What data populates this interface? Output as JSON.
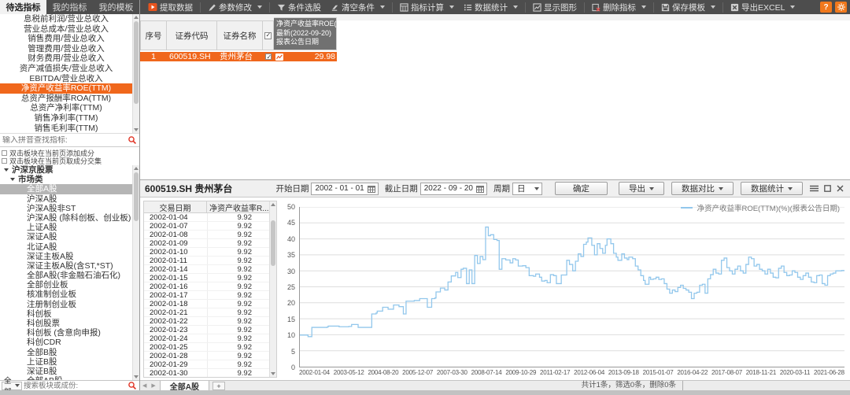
{
  "sidebar": {
    "tabs": [
      "待选指标",
      "我的指标",
      "我的模板"
    ],
    "active_tab": "待选指标",
    "indicators": [
      "息税前利润/营业总收入",
      "营业总成本/营业总收入",
      "销售费用/营业总收入",
      "管理费用/营业总收入",
      "财务费用/营业总收入",
      "资产减值损失/营业总收入",
      "EBITDA/营业总收入",
      "净资产收益率ROE(TTM)",
      "总资产报酬率ROA(TTM)",
      "总资产净利率(TTM)",
      "销售净利率(TTM)",
      "销售毛利率(TTM)"
    ],
    "selected_indicator_index": 7,
    "indicator_search_placeholder": "输入拼音查找指标:",
    "options": [
      "双击板块在当前页添加成分",
      "双击板块在当前页取成分交集"
    ],
    "tree_root": "沪深京股票",
    "tree_group": "市场类",
    "tree_items": [
      "全部A股",
      "沪深A股",
      "沪深A股非ST",
      "沪深A股 (除科创板、创业板)",
      "上证A股",
      "深证A股",
      "北证A股",
      "深证主板A股",
      "深证主板A股(含ST,*ST)",
      "全部A股(非金融石油石化)",
      "全部创业板",
      "核准制创业板",
      "注册制创业板",
      "科创板",
      "科创股票",
      "科创板 (含意向申报)",
      "科创CDR",
      "全部B股",
      "上证B股",
      "深证B股",
      "全部AB股"
    ],
    "tree_selected": "全部A股",
    "board_filter_value": "全部",
    "board_search_placeholder": "搜索板块或成份:"
  },
  "toolbar": {
    "extract": "提取数据",
    "modify_params": "参数修改",
    "stock_filter": "条件选股",
    "clear_conditions": "清空条件",
    "indicator_calc": "指标计算",
    "data_stats": "数据统计",
    "show_chart": "显示图形",
    "delete_indicator": "删除指标",
    "save_template": "保存模板",
    "export_excel": "导出EXCEL",
    "help": "?"
  },
  "results": {
    "columns": {
      "seq": "序号",
      "code": "证券代码",
      "name": "证券名称"
    },
    "indicator_column": {
      "title": "净资产收益率ROE(...",
      "line2": "最新(2022-09-20)",
      "line3": "报表公告日期"
    },
    "rows": [
      {
        "seq": "1",
        "code": "600519.SH",
        "name": "贵州茅台",
        "checked": true,
        "value": "29.98"
      }
    ]
  },
  "detail": {
    "title": "600519.SH 贵州茅台",
    "start_label": "开始日期",
    "start_value": "2002 - 01 - 01",
    "end_label": "截止日期",
    "end_value": "2022 - 09 - 20",
    "period_label": "周期",
    "period_value": "日",
    "confirm": "确定",
    "export": "导出",
    "compare": "数据对比",
    "stats": "数据统计",
    "table": {
      "date_col": "交易日期",
      "value_col": "净资产收益率R...",
      "value": "9.92",
      "dates": [
        "2002-01-04",
        "2002-01-07",
        "2002-01-08",
        "2002-01-09",
        "2002-01-10",
        "2002-01-11",
        "2002-01-14",
        "2002-01-15",
        "2002-01-16",
        "2002-01-17",
        "2002-01-18",
        "2002-01-21",
        "2002-01-22",
        "2002-01-23",
        "2002-01-24",
        "2002-01-25",
        "2002-01-28",
        "2002-01-29",
        "2002-01-30"
      ]
    },
    "tab": "全部A股",
    "add_tab": "+"
  },
  "status_bar": "共计1条，筛选0条，删除0条",
  "chart_data": {
    "type": "line",
    "step": true,
    "legend": "净资产收益率ROE(TTM)(%)(报表公告日期)",
    "series_name": "净资产收益率ROE(TTM)(%)",
    "x_range": [
      "2002-01-01",
      "2022-09-20"
    ],
    "ylim": [
      0,
      50
    ],
    "yticks": [
      0,
      5,
      10,
      15,
      20,
      25,
      30,
      35,
      40,
      45,
      50
    ],
    "x_tick_labels": [
      "2002-01-04",
      "2003-05-12",
      "2004-08-20",
      "2005-12-07",
      "2007-03-30",
      "2008-07-14",
      "2009-10-29",
      "2011-02-17",
      "2012-06-04",
      "2013-09-18",
      "2015-01-07",
      "2016-04-22",
      "2017-08-07",
      "2018-11-21",
      "2020-03-11",
      "2021-06-28"
    ],
    "line_color": "#92c7ec",
    "points": [
      [
        0,
        9.9
      ],
      [
        0.013,
        9.9
      ],
      [
        0.015,
        9.4
      ],
      [
        0.02,
        9.4
      ],
      [
        0.022,
        12.3
      ],
      [
        0.05,
        12.4
      ],
      [
        0.052,
        12.7
      ],
      [
        0.07,
        12.7
      ],
      [
        0.072,
        12.5
      ],
      [
        0.09,
        12.6
      ],
      [
        0.095,
        13.2
      ],
      [
        0.105,
        13.2
      ],
      [
        0.107,
        12.3
      ],
      [
        0.13,
        12.3
      ],
      [
        0.132,
        16.5
      ],
      [
        0.14,
        16.8
      ],
      [
        0.142,
        17.4
      ],
      [
        0.15,
        17.4
      ],
      [
        0.152,
        18.6
      ],
      [
        0.16,
        18.6
      ],
      [
        0.162,
        18.0
      ],
      [
        0.17,
        18.0
      ],
      [
        0.172,
        19.3
      ],
      [
        0.18,
        19.3
      ],
      [
        0.182,
        18.8
      ],
      [
        0.188,
        18.8
      ],
      [
        0.19,
        16.5
      ],
      [
        0.193,
        16.5
      ],
      [
        0.195,
        20.5
      ],
      [
        0.21,
        20.7
      ],
      [
        0.22,
        21.3
      ],
      [
        0.232,
        21.3
      ],
      [
        0.234,
        18.6
      ],
      [
        0.24,
        18.6
      ],
      [
        0.242,
        21.3
      ],
      [
        0.248,
        21.5
      ],
      [
        0.25,
        23.4
      ],
      [
        0.256,
        23.4
      ],
      [
        0.258,
        24.6
      ],
      [
        0.264,
        24.6
      ],
      [
        0.266,
        24.0
      ],
      [
        0.27,
        24.0
      ],
      [
        0.272,
        26.5
      ],
      [
        0.276,
        26.5
      ],
      [
        0.278,
        28.4
      ],
      [
        0.284,
        28.4
      ],
      [
        0.286,
        29.5
      ],
      [
        0.289,
        29.5
      ],
      [
        0.29,
        27.9
      ],
      [
        0.294,
        27.9
      ],
      [
        0.296,
        30.5
      ],
      [
        0.3,
        30.8
      ],
      [
        0.304,
        30.8
      ],
      [
        0.306,
        26.0
      ],
      [
        0.309,
        26.0
      ],
      [
        0.311,
        30.3
      ],
      [
        0.314,
        30.3
      ],
      [
        0.316,
        26.0
      ],
      [
        0.319,
        26.0
      ],
      [
        0.321,
        34.8
      ],
      [
        0.324,
        34.8
      ],
      [
        0.326,
        32.3
      ],
      [
        0.329,
        32.3
      ],
      [
        0.331,
        34.5
      ],
      [
        0.334,
        34.5
      ],
      [
        0.336,
        33.5
      ],
      [
        0.339,
        33.5
      ],
      [
        0.341,
        43.7
      ],
      [
        0.344,
        43.7
      ],
      [
        0.346,
        41.0
      ],
      [
        0.35,
        41.3
      ],
      [
        0.354,
        41.3
      ],
      [
        0.356,
        39.8
      ],
      [
        0.36,
        39.8
      ],
      [
        0.362,
        39.5
      ],
      [
        0.364,
        39.5
      ],
      [
        0.366,
        30.5
      ],
      [
        0.369,
        30.5
      ],
      [
        0.371,
        33.8
      ],
      [
        0.376,
        33.8
      ],
      [
        0.378,
        33.4
      ],
      [
        0.384,
        33.4
      ],
      [
        0.386,
        32.5
      ],
      [
        0.389,
        32.5
      ],
      [
        0.391,
        33.8
      ],
      [
        0.394,
        33.8
      ],
      [
        0.396,
        33.4
      ],
      [
        0.399,
        33.4
      ],
      [
        0.401,
        31.5
      ],
      [
        0.409,
        31.6
      ],
      [
        0.415,
        31.0
      ],
      [
        0.419,
        31.0
      ],
      [
        0.421,
        28.5
      ],
      [
        0.429,
        28.3
      ],
      [
        0.433,
        29.0
      ],
      [
        0.438,
        29.0
      ],
      [
        0.44,
        28.0
      ],
      [
        0.444,
        26.8
      ],
      [
        0.45,
        27.0
      ],
      [
        0.454,
        26.3
      ],
      [
        0.458,
        26.3
      ],
      [
        0.46,
        28.8
      ],
      [
        0.466,
        28.5
      ],
      [
        0.469,
        28.5
      ],
      [
        0.471,
        26.0
      ],
      [
        0.478,
        26.0
      ],
      [
        0.48,
        28.7
      ],
      [
        0.488,
        28.7
      ],
      [
        0.49,
        33.3
      ],
      [
        0.493,
        33.3
      ],
      [
        0.495,
        32.0
      ],
      [
        0.499,
        32.0
      ],
      [
        0.501,
        30.0
      ],
      [
        0.504,
        30.0
      ],
      [
        0.506,
        33.0
      ],
      [
        0.509,
        33.0
      ],
      [
        0.511,
        35.3
      ],
      [
        0.514,
        35.3
      ],
      [
        0.516,
        34.5
      ],
      [
        0.519,
        34.5
      ],
      [
        0.521,
        38.3
      ],
      [
        0.524,
        38.3
      ],
      [
        0.526,
        39.0
      ],
      [
        0.529,
        40.3
      ],
      [
        0.534,
        40.3
      ],
      [
        0.536,
        38.0
      ],
      [
        0.539,
        38.0
      ],
      [
        0.541,
        35.0
      ],
      [
        0.544,
        35.0
      ],
      [
        0.546,
        38.5
      ],
      [
        0.549,
        38.5
      ],
      [
        0.551,
        37.0
      ],
      [
        0.554,
        37.0
      ],
      [
        0.556,
        35.5
      ],
      [
        0.559,
        35.5
      ],
      [
        0.561,
        38.0
      ],
      [
        0.564,
        40.0
      ],
      [
        0.569,
        40.0
      ],
      [
        0.571,
        38.5
      ],
      [
        0.574,
        38.5
      ],
      [
        0.576,
        35.5
      ],
      [
        0.579,
        35.5
      ],
      [
        0.581,
        34.3
      ],
      [
        0.584,
        33.3
      ],
      [
        0.589,
        33.3
      ],
      [
        0.591,
        35.3
      ],
      [
        0.594,
        35.3
      ],
      [
        0.596,
        34.0
      ],
      [
        0.601,
        33.5
      ],
      [
        0.604,
        34.3
      ],
      [
        0.609,
        34.3
      ],
      [
        0.611,
        33.8
      ],
      [
        0.614,
        33.8
      ],
      [
        0.616,
        31.5
      ],
      [
        0.619,
        31.5
      ],
      [
        0.621,
        30.3
      ],
      [
        0.624,
        30.3
      ],
      [
        0.626,
        28.5
      ],
      [
        0.629,
        28.5
      ],
      [
        0.631,
        27.0
      ],
      [
        0.634,
        25.8
      ],
      [
        0.639,
        25.8
      ],
      [
        0.641,
        28.0
      ],
      [
        0.644,
        27.3
      ],
      [
        0.649,
        27.5
      ],
      [
        0.654,
        28.0
      ],
      [
        0.659,
        27.3
      ],
      [
        0.664,
        27.5
      ],
      [
        0.669,
        26.0
      ],
      [
        0.674,
        24.3
      ],
      [
        0.679,
        23.0
      ],
      [
        0.684,
        24.0
      ],
      [
        0.689,
        23.5
      ],
      [
        0.694,
        24.8
      ],
      [
        0.699,
        25.5
      ],
      [
        0.704,
        24.5
      ],
      [
        0.709,
        24.0
      ],
      [
        0.714,
        23.3
      ],
      [
        0.719,
        21.3
      ],
      [
        0.724,
        23.0
      ],
      [
        0.729,
        23.3
      ],
      [
        0.734,
        25.5
      ],
      [
        0.739,
        25.8
      ],
      [
        0.744,
        23.0
      ],
      [
        0.749,
        27.5
      ],
      [
        0.754,
        28.8
      ],
      [
        0.759,
        30.5
      ],
      [
        0.764,
        29.3
      ],
      [
        0.769,
        29.0
      ],
      [
        0.774,
        33.3
      ],
      [
        0.779,
        34.0
      ],
      [
        0.784,
        31.0
      ],
      [
        0.789,
        30.0
      ],
      [
        0.794,
        29.0
      ],
      [
        0.799,
        30.5
      ],
      [
        0.804,
        31.5
      ],
      [
        0.809,
        30.0
      ],
      [
        0.814,
        29.3
      ],
      [
        0.819,
        32.0
      ],
      [
        0.824,
        34.3
      ],
      [
        0.829,
        33.8
      ],
      [
        0.834,
        31.5
      ],
      [
        0.839,
        32.0
      ],
      [
        0.844,
        30.5
      ],
      [
        0.849,
        30.0
      ],
      [
        0.854,
        29.0
      ],
      [
        0.859,
        30.5
      ],
      [
        0.864,
        29.3
      ],
      [
        0.869,
        28.0
      ],
      [
        0.874,
        27.8
      ],
      [
        0.879,
        30.8
      ],
      [
        0.884,
        31.5
      ],
      [
        0.889,
        29.5
      ],
      [
        0.894,
        28.5
      ],
      [
        0.899,
        28.7
      ],
      [
        0.904,
        30.0
      ],
      [
        0.909,
        29.5
      ],
      [
        0.914,
        28.0
      ],
      [
        0.919,
        27.3
      ],
      [
        0.924,
        28.5
      ],
      [
        0.929,
        29.3
      ],
      [
        0.934,
        28.0
      ],
      [
        0.939,
        26.5
      ],
      [
        0.944,
        26.3
      ],
      [
        0.949,
        28.5
      ],
      [
        0.954,
        28.7
      ],
      [
        0.959,
        26.0
      ],
      [
        0.964,
        25.5
      ],
      [
        0.969,
        28.5
      ],
      [
        0.974,
        29.0
      ],
      [
        0.979,
        29.3
      ],
      [
        0.984,
        30.0
      ],
      [
        0.995,
        30.1
      ],
      [
        1,
        30.1
      ]
    ]
  }
}
